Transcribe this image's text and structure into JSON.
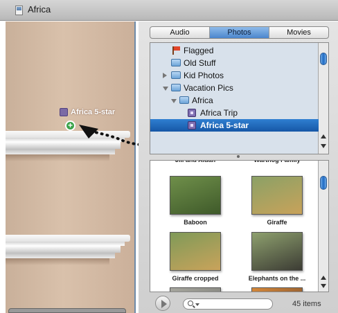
{
  "window": {
    "title": "Africa"
  },
  "drag": {
    "item_label": "Africa 5-star",
    "plus": "+"
  },
  "media_tabs": [
    {
      "label": "Audio",
      "active": false
    },
    {
      "label": "Photos",
      "active": true
    },
    {
      "label": "Movies",
      "active": false
    }
  ],
  "source_list": {
    "items": [
      {
        "label": "Flagged",
        "icon": "flag-icon",
        "indent": 0,
        "disclosure": "none",
        "selected": false
      },
      {
        "label": "Old Stuff",
        "icon": "folder-icon",
        "indent": 0,
        "disclosure": "none",
        "selected": false
      },
      {
        "label": "Kid Photos",
        "icon": "folder-icon",
        "indent": 0,
        "disclosure": "collapsed",
        "selected": false
      },
      {
        "label": "Vacation Pics",
        "icon": "folder-icon",
        "indent": 0,
        "disclosure": "expanded",
        "selected": false
      },
      {
        "label": "Africa",
        "icon": "folder-icon",
        "indent": 1,
        "disclosure": "expanded",
        "selected": false
      },
      {
        "label": "Africa Trip",
        "icon": "album-icon",
        "indent": 2,
        "disclosure": "none",
        "selected": false
      },
      {
        "label": "Africa 5-star",
        "icon": "album-icon",
        "indent": 2,
        "disclosure": "none",
        "selected": true
      }
    ]
  },
  "photos": {
    "items": [
      {
        "caption": "Jill and Aidan",
        "palette": [
          "#9a8b72",
          "#6f6350"
        ]
      },
      {
        "caption": "Warthog Family",
        "palette": [
          "#a59a7c",
          "#7b6e52"
        ]
      },
      {
        "caption": "Baboon",
        "palette": [
          "#6f8f4a",
          "#3f5a2a"
        ]
      },
      {
        "caption": "Giraffe",
        "palette": [
          "#8ba166",
          "#c8a25a"
        ]
      },
      {
        "caption": "Giraffe cropped",
        "palette": [
          "#7f9a58",
          "#c9a35b"
        ]
      },
      {
        "caption": "Elephants on the ...",
        "palette": [
          "#8ea06e",
          "#3c3c34"
        ]
      },
      {
        "caption": "",
        "palette": [
          "#a8a8a0",
          "#6c6c66"
        ]
      },
      {
        "caption": "",
        "palette": [
          "#d88a3a",
          "#5a3a2a"
        ]
      }
    ]
  },
  "footer": {
    "search_value": "",
    "item_count": "45 items"
  },
  "colors": {
    "selection": "#1f6bc4",
    "accent": "#4b86cd",
    "drag_path": "#111111"
  }
}
